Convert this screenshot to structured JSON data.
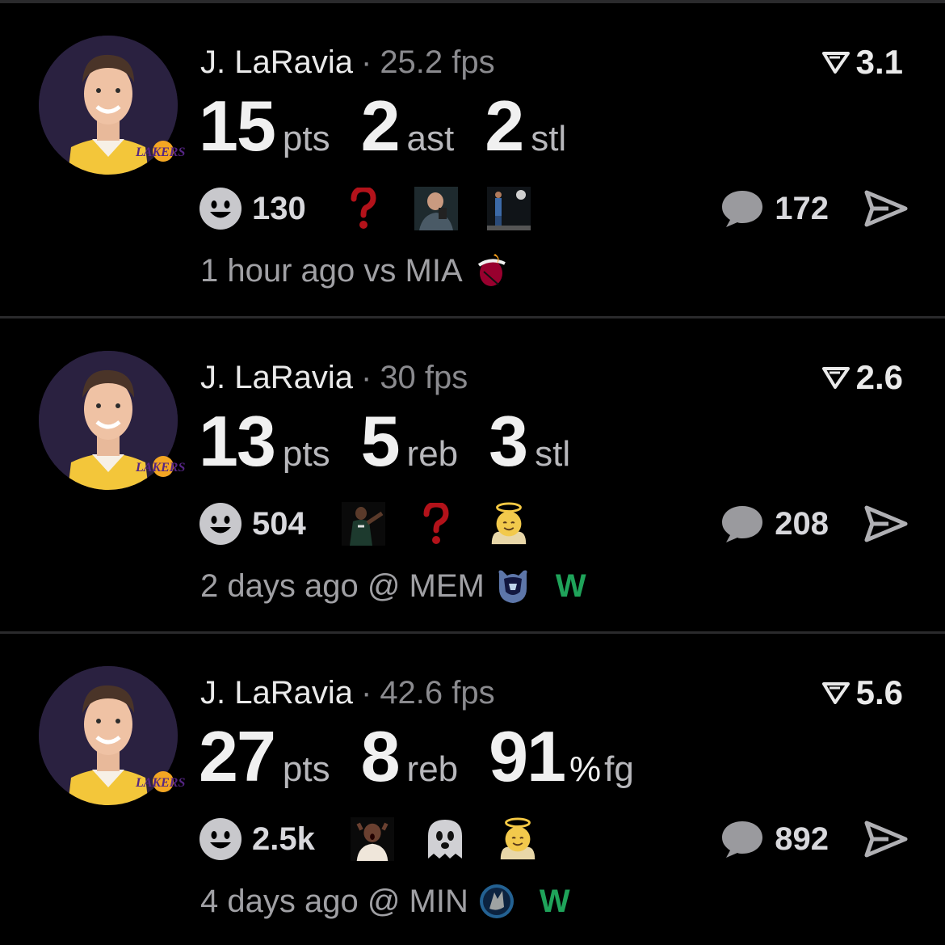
{
  "posts": [
    {
      "player": "J. LaRavia",
      "separator": "·",
      "fps": "25.2 fps",
      "score": "3.1",
      "stats": [
        {
          "value": "15",
          "unit": "pts"
        },
        {
          "value": "2",
          "unit": "ast"
        },
        {
          "value": "2",
          "unit": "stl"
        }
      ],
      "reaction_count": "130",
      "reaction_emojis": [
        "question-mark",
        "person-phone-meme",
        "player-shooting-meme"
      ],
      "comment_count": "172",
      "time": "1 hour ago",
      "matchup": "vs MIA",
      "opponent_logo": "heat-logo",
      "result": ""
    },
    {
      "player": "J. LaRavia",
      "separator": "·",
      "fps": "30 fps",
      "score": "2.6",
      "stats": [
        {
          "value": "13",
          "unit": "pts"
        },
        {
          "value": "5",
          "unit": "reb"
        },
        {
          "value": "3",
          "unit": "stl"
        }
      ],
      "reaction_count": "504",
      "reaction_emojis": [
        "player-pointing-meme",
        "question-mark",
        "angel-face"
      ],
      "comment_count": "208",
      "time": "2 days ago",
      "matchup": "@ MEM",
      "opponent_logo": "grizzlies-logo",
      "result": "W"
    },
    {
      "player": "J. LaRavia",
      "separator": "·",
      "fps": "42.6 fps",
      "score": "5.6",
      "stats": [
        {
          "value": "27",
          "unit": "pts"
        },
        {
          "value": "8",
          "unit": "reb"
        },
        {
          "value": "91",
          "pct": "%",
          "unit": "fg"
        }
      ],
      "reaction_count": "2.5k",
      "reaction_emojis": [
        "shocked-person-meme",
        "ghost",
        "angel-face"
      ],
      "comment_count": "892",
      "time": "4 days ago",
      "matchup": "@ MIN",
      "opponent_logo": "timberwolves-logo",
      "result": "W"
    }
  ],
  "colors": {
    "background": "#000000",
    "win": "#1fa35a",
    "question": "#c0141c",
    "muted": "#8a8a8e"
  }
}
